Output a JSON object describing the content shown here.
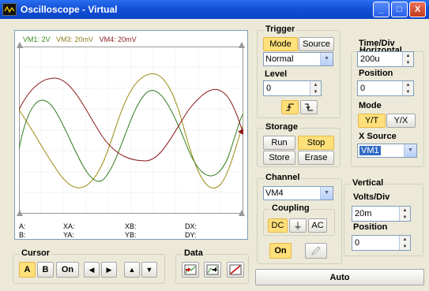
{
  "window": {
    "title": "Oscilloscope - Virtual",
    "minimize": "_",
    "maximize": "□",
    "close": "X"
  },
  "scope": {
    "legend": [
      {
        "label": "VM1: 2V",
        "color": "#3a8a22"
      },
      {
        "label": "VM3: 20mV",
        "color": "#8b7d1a"
      },
      {
        "label": "VM4: 20mV",
        "color": "#8b1a1a"
      }
    ],
    "readouts": {
      "a": "A:",
      "xa": "XA:",
      "xb": "XB:",
      "dx": "DX:",
      "b": "B:",
      "ya": "YA:",
      "yb": "YB:",
      "dy": "DY:"
    }
  },
  "trigger": {
    "title": "Trigger",
    "mode": "Mode",
    "source": "Source",
    "mode_value": "Normal",
    "level_label": "Level",
    "level_value": "0"
  },
  "horizontal": {
    "title": "Horizontal",
    "timediv_label": "Time/Div",
    "timediv_value": "200u",
    "position_label": "Position",
    "position_value": "0",
    "mode_label": "Mode",
    "yt": "Y/T",
    "yx": "Y/X",
    "xsource_label": "X Source",
    "xsource_value": "VM1"
  },
  "storage": {
    "title": "Storage",
    "run": "Run",
    "stop": "Stop",
    "store": "Store",
    "erase": "Erase"
  },
  "channel": {
    "title": "Channel",
    "value": "VM4",
    "coupling_label": "Coupling",
    "dc": "DC",
    "gnd": "⏚",
    "ac": "AC",
    "on": "On"
  },
  "vertical": {
    "title": "Vertical",
    "voltsdiv_label": "Volts/Div",
    "voltsdiv_value": "20m",
    "position_label": "Position",
    "position_value": "0"
  },
  "cursor": {
    "title": "Cursor",
    "a": "A",
    "b": "B",
    "on": "On",
    "left": "◀",
    "right": "▶",
    "up": "▲",
    "down": "▼"
  },
  "data": {
    "title": "Data"
  },
  "auto": "Auto"
}
